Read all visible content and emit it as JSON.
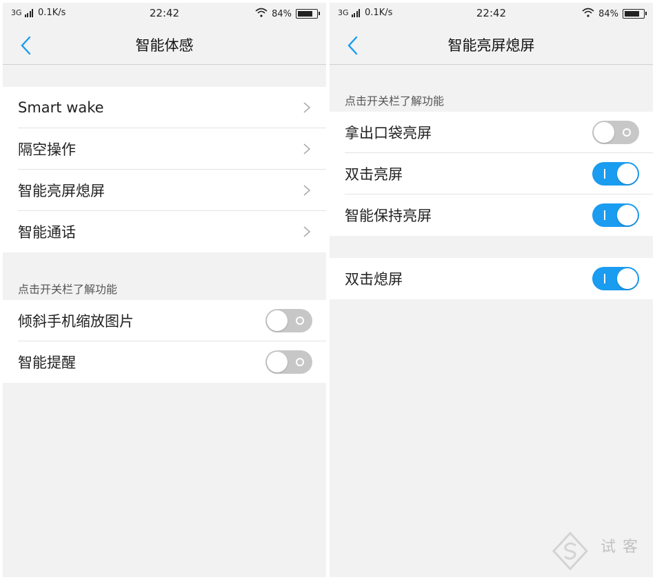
{
  "left": {
    "status": {
      "network": "3G",
      "speed": "0.1K/s",
      "time": "22:42",
      "battery": "84%",
      "battery_level": 0.84
    },
    "title": "智能体感",
    "nav_items": [
      {
        "label": "Smart wake"
      },
      {
        "label": "隔空操作"
      },
      {
        "label": "智能亮屏熄屏"
      },
      {
        "label": "智能通话"
      }
    ],
    "section_header": "点击开关栏了解功能",
    "toggles": [
      {
        "label": "倾斜手机缩放图片",
        "on": false
      },
      {
        "label": "智能提醒",
        "on": false
      }
    ]
  },
  "right": {
    "status": {
      "network": "3G",
      "speed": "0.1K/s",
      "time": "22:42",
      "battery": "84%",
      "battery_level": 0.84
    },
    "title": "智能亮屏熄屏",
    "section_header": "点击开关栏了解功能",
    "toggles": [
      {
        "label": "拿出口袋亮屏",
        "on": false
      },
      {
        "label": "双击亮屏",
        "on": true
      },
      {
        "label": "智能保持亮屏",
        "on": true
      }
    ],
    "toggles2": [
      {
        "label": "双击熄屏",
        "on": true
      }
    ]
  },
  "watermark": {
    "text": "试客"
  },
  "colors": {
    "accent": "#1a9cf0",
    "toggle_off": "#c7c7c7",
    "background": "#f2f2f2"
  },
  "icons": {
    "back": "chevron-left-icon",
    "forward": "chevron-right-icon",
    "wifi": "wifi-icon",
    "battery": "battery-icon",
    "signal": "signal-icon"
  }
}
